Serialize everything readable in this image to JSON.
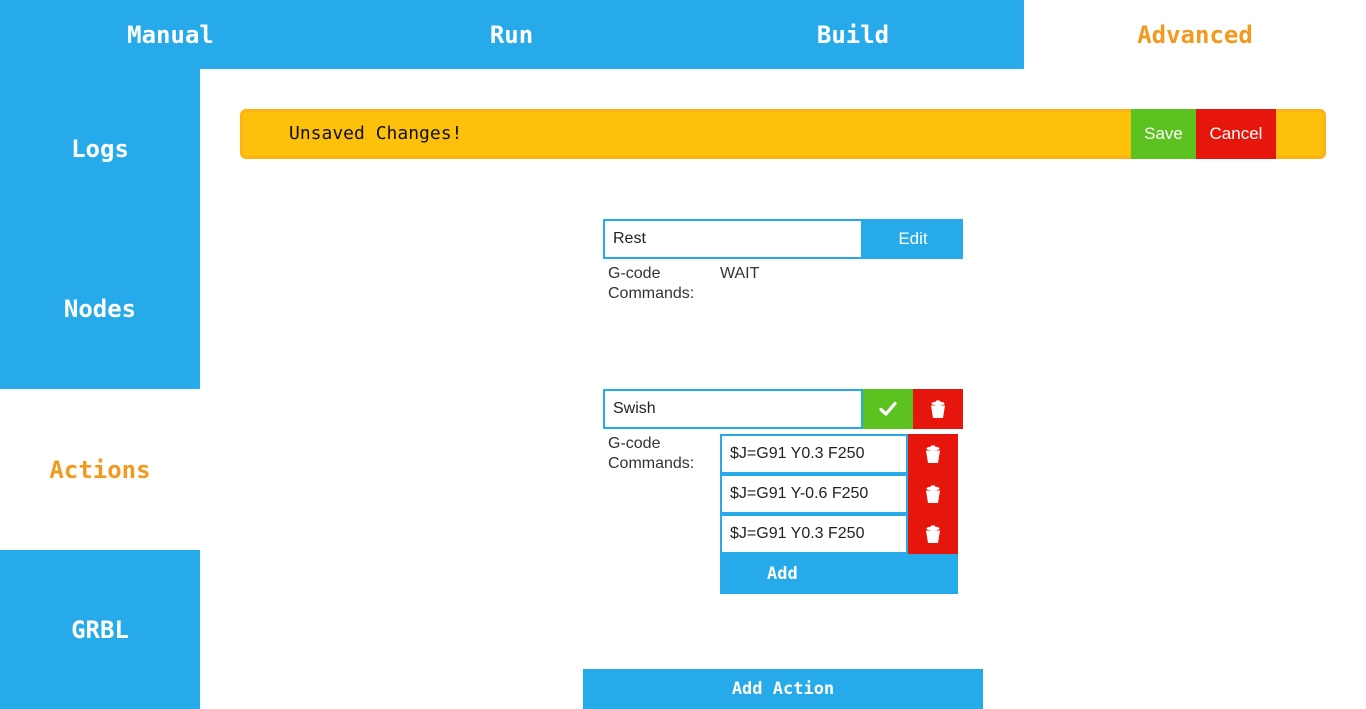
{
  "tabs": [
    {
      "label": "Manual"
    },
    {
      "label": "Run"
    },
    {
      "label": "Build"
    },
    {
      "label": "Advanced",
      "active": true
    }
  ],
  "sidebar": {
    "items": [
      {
        "label": "Logs"
      },
      {
        "label": "Nodes"
      },
      {
        "label": "Actions",
        "active": true
      },
      {
        "label": "GRBL"
      }
    ]
  },
  "banner": {
    "text": "Unsaved Changes!",
    "save_label": "Save",
    "cancel_label": "Cancel"
  },
  "actions": [
    {
      "name": "Rest",
      "edit_label": "Edit",
      "commands_label": "G-code Commands:",
      "commands_value": "WAIT"
    },
    {
      "name": "Swish",
      "confirm_icon": "check-icon",
      "delete_icon": "trash-icon",
      "commands_label": "G-code Commands:",
      "commands": [
        "$J=G91 Y0.3 F250",
        "$J=G91 Y-0.6 F250",
        "$J=G91 Y0.3 F250"
      ],
      "add_label": "Add"
    }
  ],
  "add_action_label": "Add Action",
  "colors": {
    "primary": "#27aae9",
    "accent": "#f29a1f",
    "warning": "#fec10b",
    "success": "#5cc21f",
    "danger": "#e6160c"
  }
}
